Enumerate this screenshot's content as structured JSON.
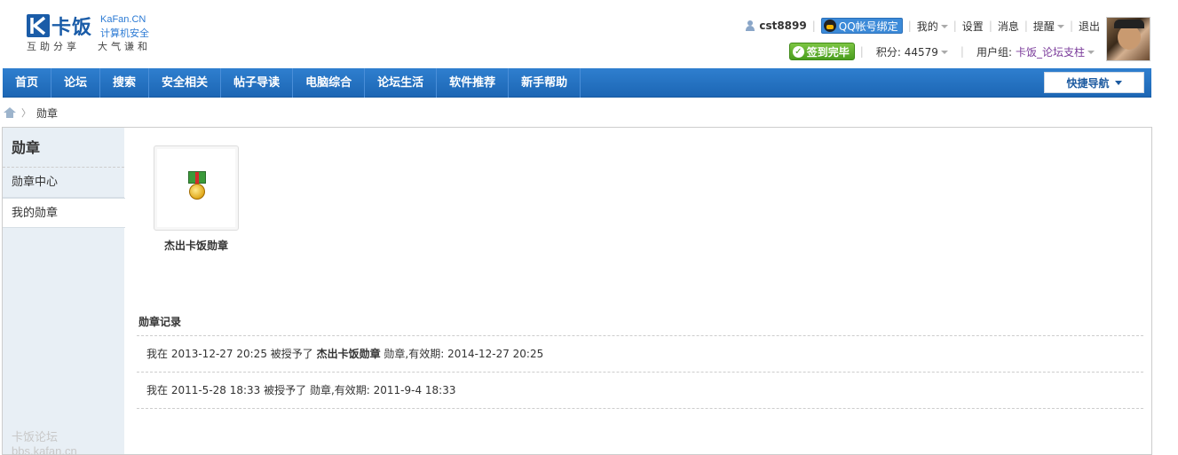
{
  "header": {
    "logo": {
      "main": "卡饭",
      "en": "KaFan.CN",
      "cn": "计算机安全",
      "slogan_left": "互助分享",
      "slogan_right": "大气谦和"
    },
    "user": {
      "name": "cst8899",
      "qq_bind": "QQ帐号绑定",
      "my": "我的",
      "settings": "设置",
      "messages": "消息",
      "reminders": "提醒",
      "logout": "退出",
      "signed": "签到完毕",
      "points_label": "积分: 44579",
      "group_label": "用户组:",
      "group_value": "卡饭_论坛支柱"
    }
  },
  "nav": {
    "items": [
      "首页",
      "论坛",
      "搜索",
      "安全相关",
      "帖子导读",
      "电脑综合",
      "论坛生活",
      "软件推荐",
      "新手帮助"
    ],
    "quick_nav": "快捷导航"
  },
  "breadcrumb": {
    "current": "勋章"
  },
  "sidebar": {
    "title": "勋章",
    "items": [
      {
        "label": "勋章中心",
        "active": false
      },
      {
        "label": "我的勋章",
        "active": true
      }
    ],
    "watermark": "卡饭论坛 bbs.kafan.cn"
  },
  "content": {
    "medals": [
      {
        "name": "杰出卡饭勋章",
        "icon": "medal-icon"
      }
    ],
    "records_title": "勋章记录",
    "records": [
      {
        "prefix": "我在 2013-12-27 20:25 被授予了 ",
        "medal": "杰出卡饭勋章",
        "suffix": " 勋章,有效期: 2014-12-27 20:25"
      },
      {
        "prefix": "我在 2011-5-28 18:33 被授予了 ",
        "medal": "",
        "suffix": " 勋章,有效期: 2011-9-4 18:33"
      }
    ]
  },
  "colors": {
    "nav_bg": "#1c66b4",
    "sidebar_bg": "#e8eff5",
    "usergroup": "#7a3a9a",
    "sign_green": "#4a9e1e"
  }
}
